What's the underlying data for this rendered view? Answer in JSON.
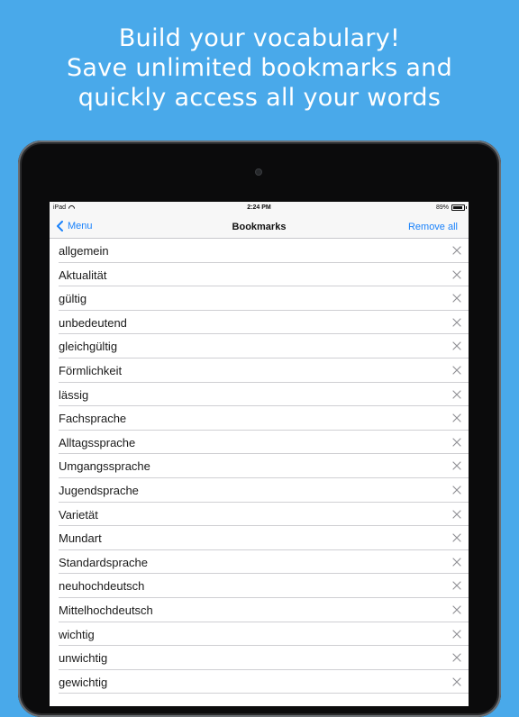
{
  "promo": {
    "line1": "Build your vocabulary!",
    "line2": "Save unlimited bookmarks and",
    "line3": "quickly access all your words"
  },
  "status_bar": {
    "device": "iPad",
    "time": "2:24 PM",
    "battery": "89%",
    "battery_level": 0.89
  },
  "nav": {
    "back_label": "Menu",
    "title": "Bookmarks",
    "action_label": "Remove all"
  },
  "bookmarks": [
    "allgemein",
    "Aktualität",
    "gültig",
    "unbedeutend",
    "gleichgültig",
    "Förmlichkeit",
    "lässig",
    "Fachsprache",
    "Alltagssprache",
    "Umgangssprache",
    "Jugendsprache",
    "Varietät",
    "Mundart",
    "Standardsprache",
    "neuhochdeutsch",
    "Mittelhochdeutsch",
    "wichtig",
    "unwichtig",
    "gewichtig"
  ],
  "colors": {
    "background": "#49a9ea",
    "accent": "#1a82fb"
  },
  "icons": {
    "back": "chevron-left-icon",
    "remove": "close-icon",
    "wifi": "wifi-icon",
    "battery": "battery-icon"
  }
}
